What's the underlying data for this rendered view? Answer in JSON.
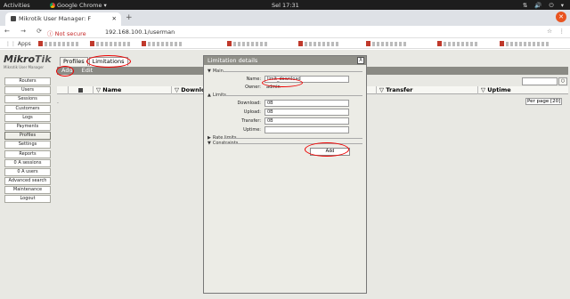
{
  "os": {
    "activities": "Activities",
    "app_name": "Google Chrome",
    "clock": "Sel 17:31"
  },
  "browser": {
    "tab_title": "Mikrotik User Manager: F",
    "not_secure": "Not secure",
    "url": "192.168.100.1/userman",
    "apps_label": "Apps"
  },
  "app": {
    "logo_main": "Mikro",
    "logo_bold": "Tik",
    "logo_sub": "Mikrotik User Manager",
    "sidebar": [
      "Routers",
      "Users",
      "Sessions",
      "Customers",
      "Logs",
      "Payments",
      "Profiles",
      "Settings",
      "Reports",
      "0 A sessions",
      "0 A users",
      "Advanced search",
      "Maintenance",
      "Logout"
    ],
    "tabs": [
      "Profiles",
      "Limitations"
    ],
    "actions": [
      "Add",
      "Edit"
    ],
    "columns": [
      "Name",
      "Download",
      "Transfer",
      "Uptime"
    ],
    "per_page": "Per page [20]",
    "empty_marker": "-"
  },
  "modal": {
    "title": "Limitation details",
    "close": "X",
    "sections": {
      "main": "Main",
      "limits": "Limits",
      "rate_limits": "Rate limits",
      "constraints": "Constraints"
    },
    "fields": {
      "name_label": "Name:",
      "name_value": "limit_download",
      "owner_label": "Owner:",
      "owner_value": "admin",
      "download_label": "Download:",
      "download_value": "0B",
      "upload_label": "Upload:",
      "upload_value": "0B",
      "transfer_label": "Transfer:",
      "transfer_value": "0B",
      "uptime_label": "Uptime:",
      "uptime_value": ""
    },
    "add_button": "Add"
  }
}
